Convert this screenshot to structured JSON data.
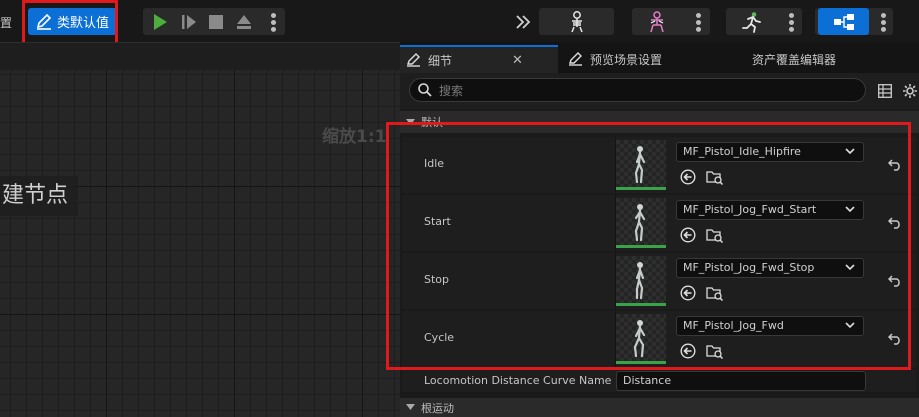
{
  "toolbar": {
    "partial_left_label": "置",
    "class_defaults_label": "类默认值"
  },
  "graph": {
    "zoom_label": "缩放1:1",
    "node_title": "建节点"
  },
  "tabs": [
    {
      "label": "细节"
    },
    {
      "label": "预览场景设置"
    },
    {
      "label": "资产覆盖编辑器"
    }
  ],
  "search": {
    "placeholder": "搜索"
  },
  "category_default": "默认",
  "properties": [
    {
      "name": "Idle",
      "value": "MF_Pistol_Idle_Hipfire"
    },
    {
      "name": "Start",
      "value": "MF_Pistol_Jog_Fwd_Start"
    },
    {
      "name": "Stop",
      "value": "MF_Pistol_Jog_Fwd_Stop"
    },
    {
      "name": "Cycle",
      "value": "MF_Pistol_Jog_Fwd"
    }
  ],
  "curve_property": {
    "name": "Locomotion Distance Curve Name",
    "value": "Distance"
  },
  "category_root_motion": "根运动",
  "colors": {
    "accent": "#0b6fd6",
    "highlight": "#e0191c",
    "play": "#4caf3d"
  }
}
